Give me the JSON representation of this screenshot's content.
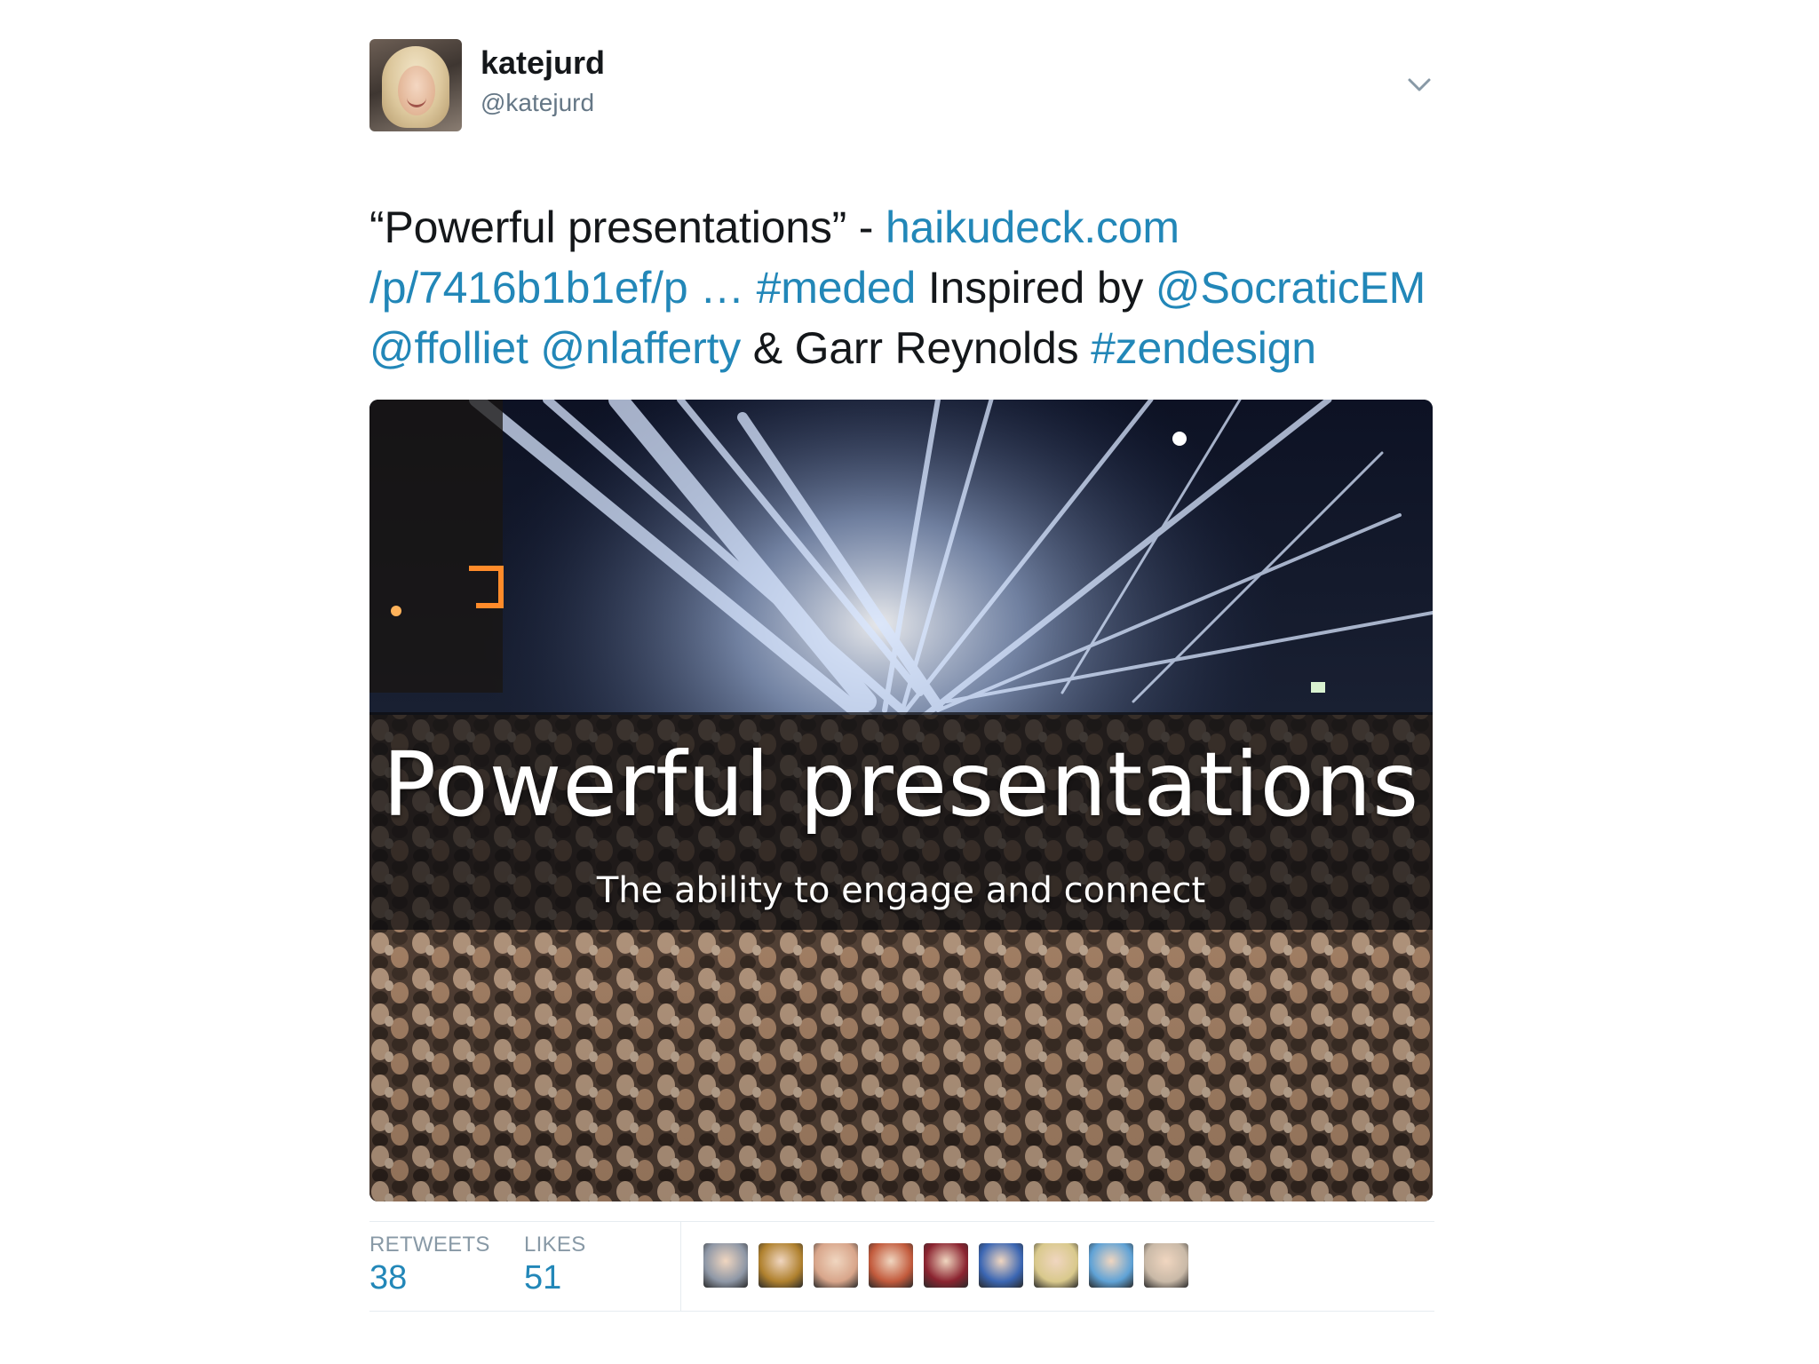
{
  "header": {
    "display_name": "katejurd",
    "username": "@katejurd"
  },
  "tweet": {
    "segments": [
      {
        "text": "“Powerful presentations” - ",
        "type": "text"
      },
      {
        "text": "haikudeck.com /p/7416b1b1ef/p …",
        "type": "link"
      },
      {
        "text": " ",
        "type": "text"
      },
      {
        "text": "#meded",
        "type": "hashtag"
      },
      {
        "text": " Inspired by ",
        "type": "text"
      },
      {
        "text": "@SocraticEM",
        "type": "mention"
      },
      {
        "text": " ",
        "type": "text"
      },
      {
        "text": "@ffolliet",
        "type": "mention"
      },
      {
        "text": " ",
        "type": "text"
      },
      {
        "text": "@nlafferty",
        "type": "mention"
      },
      {
        "text": " & Garr Reynolds ",
        "type": "text"
      },
      {
        "text": "#zendesign",
        "type": "hashtag"
      }
    ],
    "link_color": "#2287b8"
  },
  "media": {
    "title": "Powerful presentations",
    "subtitle": "The ability to engage and connect"
  },
  "stats": {
    "retweets_label": "RETWEETS",
    "retweets_value": "38",
    "likes_label": "LIKES",
    "likes_value": "51"
  },
  "likers": [
    {
      "name": "liker-avatar-1",
      "color": "#8e97a6"
    },
    {
      "name": "liker-avatar-2",
      "color": "#b0812e"
    },
    {
      "name": "liker-avatar-3",
      "color": "#d8a58a"
    },
    {
      "name": "liker-avatar-4",
      "color": "#c25a3c"
    },
    {
      "name": "liker-avatar-5",
      "color": "#8b2430"
    },
    {
      "name": "liker-avatar-6",
      "color": "#3b66b3"
    },
    {
      "name": "liker-avatar-7",
      "color": "#d9c98c"
    },
    {
      "name": "liker-avatar-8",
      "color": "#5fa2d6"
    },
    {
      "name": "liker-avatar-9",
      "color": "#c9b9a7"
    }
  ]
}
